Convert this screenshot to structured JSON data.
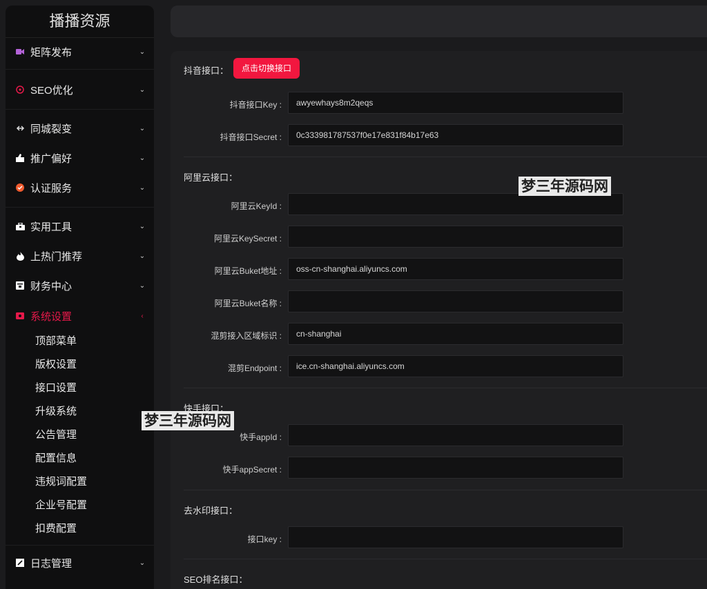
{
  "sidebar": {
    "brand": "播播资源",
    "items": [
      {
        "label": "矩阵发布",
        "icon": "video-icon"
      },
      {
        "label": "SEO优化",
        "icon": "seo-icon"
      },
      {
        "label": "同城裂变",
        "icon": "link-icon"
      },
      {
        "label": "推广偏好",
        "icon": "thumb-icon"
      },
      {
        "label": "认证服务",
        "icon": "verified-icon"
      },
      {
        "label": "实用工具",
        "icon": "toolbox-icon"
      },
      {
        "label": "上热门推荐",
        "icon": "fire-icon"
      },
      {
        "label": "财务中心",
        "icon": "wallet-icon"
      },
      {
        "label": "系统设置",
        "icon": "settings-icon"
      },
      {
        "label": "日志管理",
        "icon": "log-icon"
      }
    ],
    "sub_items": [
      "顶部菜单",
      "版权设置",
      "接口设置",
      "升级系统",
      "公告管理",
      "配置信息",
      "违规词配置",
      "企业号配置",
      "扣费配置"
    ],
    "chevron_down": "⌄",
    "chevron_left": "‹"
  },
  "colors": {
    "accent": "#f2173f",
    "active": "#e6194a"
  },
  "douyin": {
    "title": "抖音接口：",
    "switch_label": "点击切换接口",
    "key_label": "抖音接口Key :",
    "key_value": "awyewhays8m2qeqs",
    "secret_label": "抖音接口Secret :",
    "secret_value": "0c333981787537f0e17e831f84b17e63"
  },
  "aliyun": {
    "title": "阿里云接口：",
    "keyid_label": "阿里云KeyId :",
    "keyid_value": "",
    "keysecret_label": "阿里云KeySecret :",
    "keysecret_value": "",
    "buket_addr_label": "阿里云Buket地址 :",
    "buket_addr_value": "oss-cn-shanghai.aliyuncs.com",
    "buket_name_label": "阿里云Buket名称 :",
    "buket_name_value": "",
    "region_label": "混剪接入区域标识 :",
    "region_value": "cn-shanghai",
    "endpoint_label": "混剪Endpoint :",
    "endpoint_value": "ice.cn-shanghai.aliyuncs.com"
  },
  "kuaishou": {
    "title": "快手接口：",
    "appid_label": "快手appId :",
    "appid_value": "",
    "appsecret_label": "快手appSecret :",
    "appsecret_value": ""
  },
  "watermark_api": {
    "title": "去水印接口：",
    "key_label": "接口key :",
    "key_value": ""
  },
  "seo_rank": {
    "title": "SEO排名接口："
  },
  "watermarks": [
    "梦三年源码网",
    "梦三年源码网"
  ]
}
